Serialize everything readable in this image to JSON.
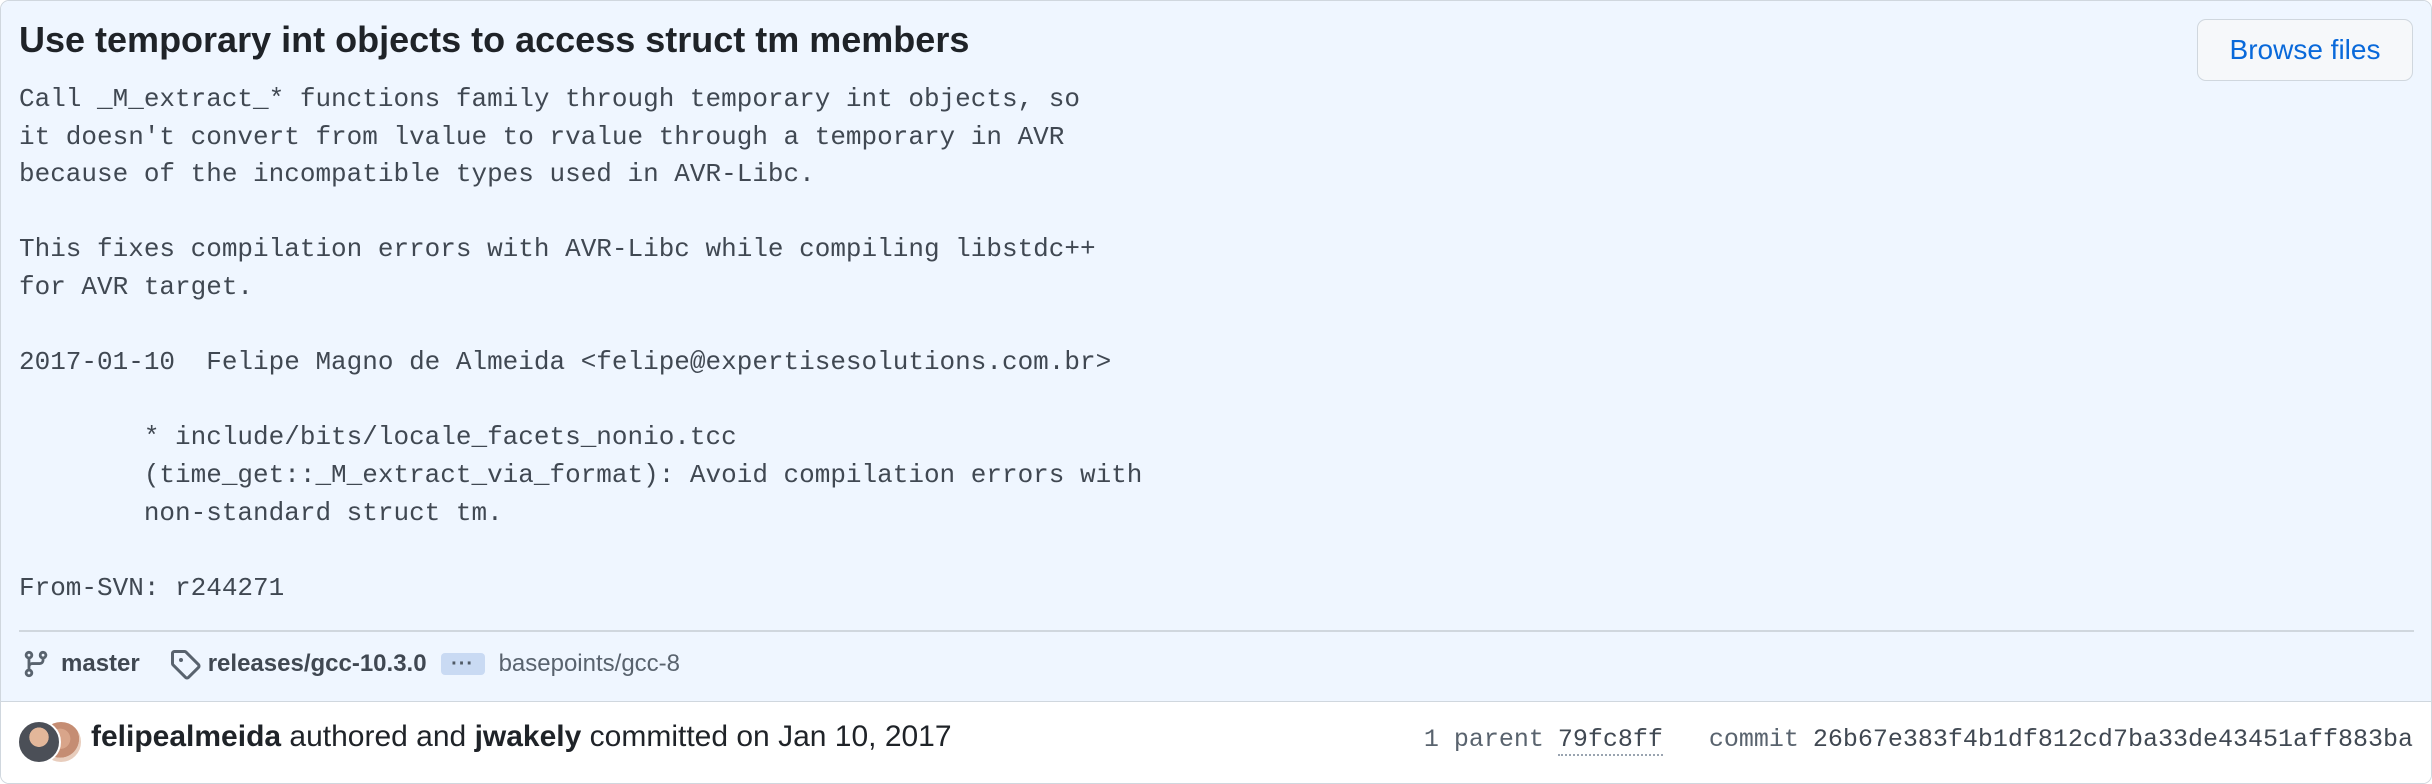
{
  "commit": {
    "title": "Use temporary int objects to access struct tm members",
    "browse_label": "Browse files",
    "message": "Call _M_extract_* functions family through temporary int objects, so\nit doesn't convert from lvalue to rvalue through a temporary in AVR\nbecause of the incompatible types used in AVR-Libc.\n\nThis fixes compilation errors with AVR-Libc while compiling libstdc++\nfor AVR target.\n\n2017-01-10  Felipe Magno de Almeida <felipe@expertisesolutions.com.br>\n\n        * include/bits/locale_facets_nonio.tcc\n        (time_get::_M_extract_via_format): Avoid compilation errors with\n        non-standard struct tm.\n\nFrom-SVN: r244271"
  },
  "refs": {
    "branch": "master",
    "tag": "releases/gcc-10.3.0",
    "ellipsis": "···",
    "basepoint": "basepoints/gcc-8",
    "branch_icon": "git-branch-icon",
    "tag_icon": "tag-icon"
  },
  "footer": {
    "author": "felipealmeida",
    "authored_text": " authored and ",
    "committer": "jwakely",
    "committed_text": " committed on Jan 10, 2017",
    "parent_label": "1 parent",
    "parent_sha": "79fc8ff",
    "commit_label": "commit",
    "commit_sha": "26b67e383f4b1df812cd7ba33de43451aff883ba"
  },
  "colors": {
    "header_bg": "#eff6ff",
    "link": "#0969da",
    "text": "#1f2328",
    "muted": "#59636e",
    "border": "#d0d7de"
  }
}
